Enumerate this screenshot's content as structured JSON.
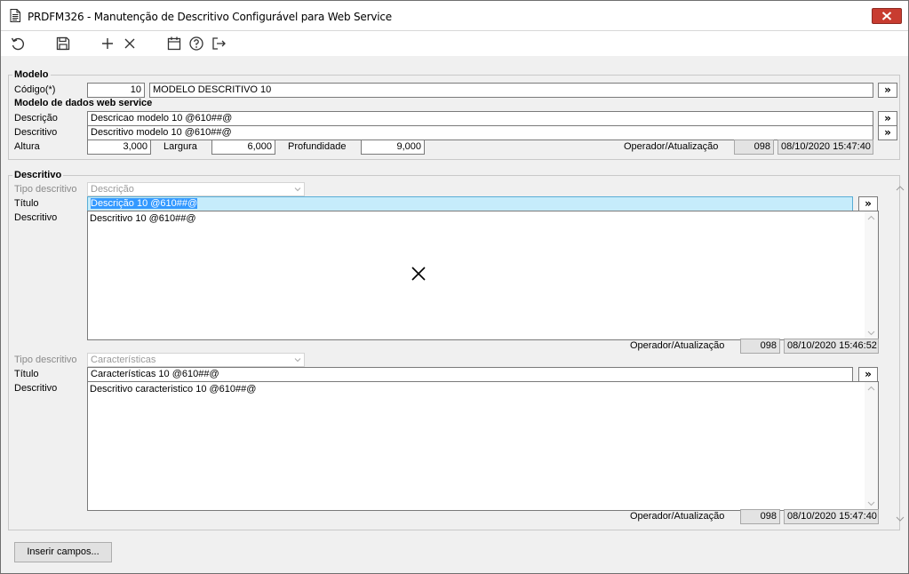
{
  "window": {
    "title": "PRDFM326 - Manutenção de Descritivo Configurável para Web Service"
  },
  "toolbar": {
    "buttons": [
      {
        "name": "refresh",
        "icon": "undo-icon"
      },
      {
        "name": "save",
        "icon": "save-icon"
      },
      {
        "name": "add",
        "icon": "plus-icon"
      },
      {
        "name": "delete",
        "icon": "close-icon"
      },
      {
        "name": "calendar",
        "icon": "calendar-icon"
      },
      {
        "name": "help",
        "icon": "help-icon"
      },
      {
        "name": "exit",
        "icon": "exit-icon"
      }
    ]
  },
  "modelo": {
    "title": "Modelo",
    "codigo_label": "Código(*)",
    "codigo_value": "10",
    "codigo_desc": "MODELO DESCRITIVO 10",
    "expand_label": "»"
  },
  "ws": {
    "title": "Modelo de dados web service",
    "descricao_label": "Descrição",
    "descricao_value": "Descricao modelo 10 @610##@",
    "descritivo_label": "Descritivo",
    "descritivo_value": "Descritivo modelo 10 @610##@",
    "altura_label": "Altura",
    "altura_value": "3,000",
    "largura_label": "Largura",
    "largura_value": "6,000",
    "profundidade_label": "Profundidade",
    "profundidade_value": "9,000",
    "operador_label": "Operador/Atualização",
    "operador_value": "098",
    "atualizacao_value": "08/10/2020 15:47:40"
  },
  "descritivo": {
    "title": "Descritivo",
    "blocks": [
      {
        "tipo_label": "Tipo descritivo",
        "tipo_value": "Descrição",
        "titulo_label": "Título",
        "titulo_value": "Descrição 10 @610##@",
        "descritivo_label": "Descritivo",
        "descritivo_value": "Descritivo 10 @610##@",
        "operador_label": "Operador/Atualização",
        "operador_value": "098",
        "atualizacao_value": "08/10/2020 15:46:52"
      },
      {
        "tipo_label": "Tipo descritivo",
        "tipo_value": "Características",
        "titulo_label": "Título",
        "titulo_value": "Características 10 @610##@",
        "descritivo_label": "Descritivo",
        "descritivo_value": "Descritivo caracteristico 10 @610##@",
        "operador_label": "Operador/Atualização",
        "operador_value": "098",
        "atualizacao_value": "08/10/2020 15:47:40"
      }
    ]
  },
  "footer": {
    "inserir_label": "Inserir campos..."
  },
  "colors": {
    "close": "#c83c30",
    "selection": "#3399ff",
    "selected_field": "#c6ecfb"
  }
}
